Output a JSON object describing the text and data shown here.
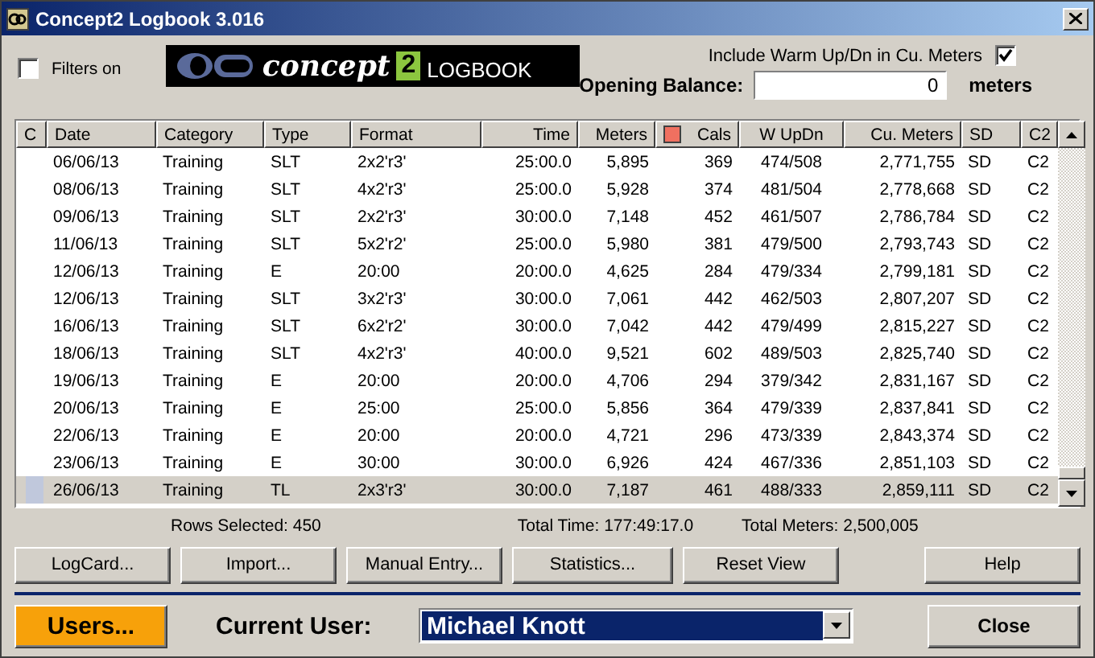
{
  "window": {
    "title": "Concept2 Logbook 3.016"
  },
  "filters": {
    "label": "Filters on",
    "checked": false
  },
  "logo": {
    "brand": "concept",
    "number": "2",
    "product": "LOGBOOK"
  },
  "warmup": {
    "label": "Include Warm Up/Dn in Cu. Meters",
    "checked": true
  },
  "opening_balance": {
    "label": "Opening Balance:",
    "value": "0",
    "unit": "meters"
  },
  "table": {
    "columns": [
      "C",
      "Date",
      "Category",
      "Type",
      "Format",
      "Time",
      "Meters",
      "Cals",
      "W UpDn",
      "Cu. Meters",
      "SD",
      "C2"
    ],
    "rows": [
      {
        "cells": [
          "",
          "06/06/13",
          "Training",
          "SLT",
          "2x2'r3'",
          "25:00.0",
          "5,895",
          "369",
          "474/508",
          "2,771,755",
          "SD",
          "C2"
        ],
        "selected": false
      },
      {
        "cells": [
          "",
          "08/06/13",
          "Training",
          "SLT",
          "4x2'r3'",
          "25:00.0",
          "5,928",
          "374",
          "481/504",
          "2,778,668",
          "SD",
          "C2"
        ],
        "selected": false
      },
      {
        "cells": [
          "",
          "09/06/13",
          "Training",
          "SLT",
          "2x2'r3'",
          "30:00.0",
          "7,148",
          "452",
          "461/507",
          "2,786,784",
          "SD",
          "C2"
        ],
        "selected": false
      },
      {
        "cells": [
          "",
          "11/06/13",
          "Training",
          "SLT",
          "5x2'r2'",
          "25:00.0",
          "5,980",
          "381",
          "479/500",
          "2,793,743",
          "SD",
          "C2"
        ],
        "selected": false
      },
      {
        "cells": [
          "",
          "12/06/13",
          "Training",
          "E",
          "20:00",
          "20:00.0",
          "4,625",
          "284",
          "479/334",
          "2,799,181",
          "SD",
          "C2"
        ],
        "selected": false
      },
      {
        "cells": [
          "",
          "12/06/13",
          "Training",
          "SLT",
          "3x2'r3'",
          "30:00.0",
          "7,061",
          "442",
          "462/503",
          "2,807,207",
          "SD",
          "C2"
        ],
        "selected": false
      },
      {
        "cells": [
          "",
          "16/06/13",
          "Training",
          "SLT",
          "6x2'r2'",
          "30:00.0",
          "7,042",
          "442",
          "479/499",
          "2,815,227",
          "SD",
          "C2"
        ],
        "selected": false
      },
      {
        "cells": [
          "",
          "18/06/13",
          "Training",
          "SLT",
          "4x2'r3'",
          "40:00.0",
          "9,521",
          "602",
          "489/503",
          "2,825,740",
          "SD",
          "C2"
        ],
        "selected": false
      },
      {
        "cells": [
          "",
          "19/06/13",
          "Training",
          "E",
          "20:00",
          "20:00.0",
          "4,706",
          "294",
          "379/342",
          "2,831,167",
          "SD",
          "C2"
        ],
        "selected": false
      },
      {
        "cells": [
          "",
          "20/06/13",
          "Training",
          "E",
          "25:00",
          "25:00.0",
          "5,856",
          "364",
          "479/339",
          "2,837,841",
          "SD",
          "C2"
        ],
        "selected": false
      },
      {
        "cells": [
          "",
          "22/06/13",
          "Training",
          "E",
          "20:00",
          "20:00.0",
          "4,721",
          "296",
          "473/339",
          "2,843,374",
          "SD",
          "C2"
        ],
        "selected": false
      },
      {
        "cells": [
          "",
          "23/06/13",
          "Training",
          "E",
          "30:00",
          "30:00.0",
          "6,926",
          "424",
          "467/336",
          "2,851,103",
          "SD",
          "C2"
        ],
        "selected": false
      },
      {
        "cells": [
          "",
          "26/06/13",
          "Training",
          "TL",
          "2x3'r3'",
          "30:00.0",
          "7,187",
          "461",
          "488/333",
          "2,859,111",
          "SD",
          "C2"
        ],
        "selected": true
      }
    ]
  },
  "totals": [
    "Rows Selected: 450",
    "Total Time: 177:49:17.0",
    "Total Meters: 2,500,005"
  ],
  "buttons": [
    "LogCard...",
    "Import...",
    "Manual Entry...",
    "Statistics...",
    "Reset View",
    "Help"
  ],
  "users_button": "Users...",
  "current_user": {
    "label": "Current User:",
    "value": "Michael Knott"
  },
  "close_button": "Close"
}
